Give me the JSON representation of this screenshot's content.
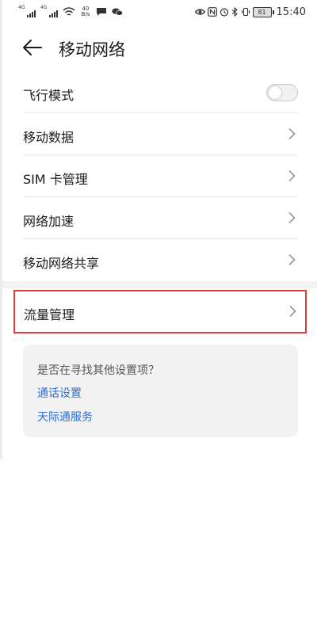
{
  "status_bar": {
    "sim1_network": "4G",
    "sim2_network": "4G",
    "net_speed_value": "40",
    "net_speed_unit": "B/s",
    "battery": "81",
    "time": "15:40"
  },
  "header": {
    "title": "移动网络"
  },
  "settings": [
    {
      "label": "飞行模式",
      "type": "toggle",
      "on": false
    },
    {
      "label": "移动数据",
      "type": "link"
    },
    {
      "label": "SIM 卡管理",
      "type": "link"
    },
    {
      "label": "网络加速",
      "type": "link"
    },
    {
      "label": "移动网络共享",
      "type": "link"
    }
  ],
  "highlighted_item": {
    "label": "流量管理",
    "highlight_color": "#e33b3b"
  },
  "suggestions": {
    "question": "是否在寻找其他设置项？",
    "links": [
      "通话设置",
      "天际通服务"
    ],
    "link_color": "#2a6fd6"
  }
}
